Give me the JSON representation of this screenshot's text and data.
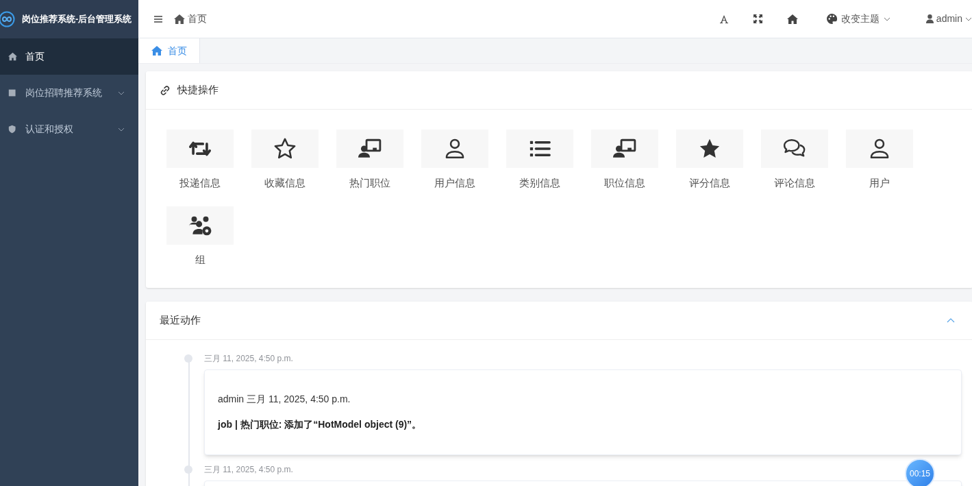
{
  "app_title": "岗位推荐系统-后台管理系统",
  "sidebar": {
    "items": [
      {
        "label": "首页",
        "kind": "home",
        "selected": true,
        "expandable": false
      },
      {
        "label": "岗位招聘推荐系统",
        "kind": "square",
        "selected": false,
        "expandable": true
      },
      {
        "label": "认证和授权",
        "kind": "shield",
        "selected": false,
        "expandable": true
      }
    ]
  },
  "header": {
    "breadcrumb": "首页",
    "theme_menu": "改变主题",
    "user_menu": "admin"
  },
  "tabs": [
    {
      "label": "首页",
      "selected": true
    }
  ],
  "quick_actions": {
    "title": "快捷操作",
    "items": [
      {
        "label": "投递信息",
        "kind": "retweet"
      },
      {
        "label": "收藏信息",
        "kind": "star-outline"
      },
      {
        "label": "热门职位",
        "kind": "presenter"
      },
      {
        "label": "用户信息",
        "kind": "user-outline"
      },
      {
        "label": "类别信息",
        "kind": "list"
      },
      {
        "label": "职位信息",
        "kind": "presenter"
      },
      {
        "label": "评分信息",
        "kind": "star-solid"
      },
      {
        "label": "评论信息",
        "kind": "comments"
      },
      {
        "label": "用户",
        "kind": "user-outline"
      },
      {
        "label": "组",
        "kind": "users-gear"
      }
    ]
  },
  "recent_actions": {
    "title": "最近动作",
    "expanded": true,
    "entries": [
      {
        "date": "三月 11, 2025, 4:50 p.m.",
        "user_line": "admin 三月 11, 2025, 4:50 p.m.",
        "message": "job | 热门职位: 添加了“HotModel object (9)”。"
      },
      {
        "date": "三月 11, 2025, 4:50 p.m."
      }
    ]
  },
  "timer": "00:15"
}
